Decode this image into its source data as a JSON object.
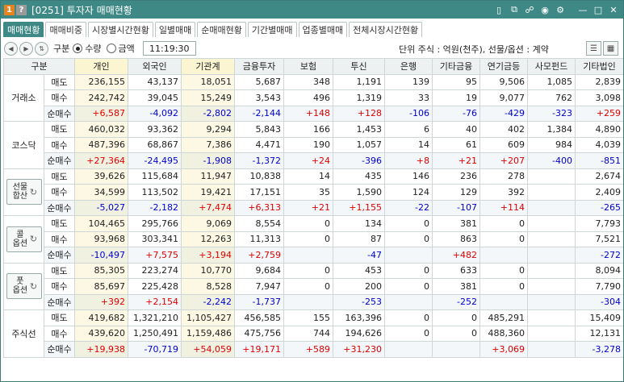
{
  "window": {
    "badge1": "1",
    "badge2": "?",
    "title": "[0251] 투자자 매매현황"
  },
  "tabs": [
    "매매현황",
    "매매비중",
    "시장별시간현황",
    "일별매매",
    "순매매현황",
    "기간별매매",
    "업종별매매",
    "전체시장시간현황"
  ],
  "toolbar": {
    "gubun_label": "구분",
    "radio_qty": "수량",
    "radio_amt": "금액",
    "time": "11:19:30",
    "unit_text": "단위 주식 : 억원(천주), 선물/옵션 : 계약"
  },
  "columns": [
    "구분",
    "개인",
    "외국인",
    "기관계",
    "금융투자",
    "보험",
    "투신",
    "은행",
    "기타금융",
    "연기금등",
    "사모펀드",
    "기타법인"
  ],
  "row_types": [
    "매도",
    "매수",
    "순매수"
  ],
  "groups": [
    {
      "name": "거래소",
      "button": false,
      "rows": [
        [
          "236,155",
          "43,137",
          "18,051",
          "5,687",
          "348",
          "1,191",
          "139",
          "95",
          "9,506",
          "1,085",
          "2,839"
        ],
        [
          "242,742",
          "39,045",
          "15,249",
          "3,543",
          "496",
          "1,319",
          "33",
          "19",
          "9,077",
          "762",
          "3,098"
        ],
        [
          "+6,587",
          "-4,092",
          "-2,802",
          "-2,144",
          "+148",
          "+128",
          "-106",
          "-76",
          "-429",
          "-323",
          "+259"
        ]
      ]
    },
    {
      "name": "코스닥",
      "button": false,
      "rows": [
        [
          "460,032",
          "93,362",
          "9,294",
          "5,843",
          "166",
          "1,453",
          "6",
          "40",
          "402",
          "1,384",
          "4,890"
        ],
        [
          "487,396",
          "68,867",
          "7,386",
          "4,471",
          "190",
          "1,057",
          "14",
          "61",
          "609",
          "984",
          "4,039"
        ],
        [
          "+27,364",
          "-24,495",
          "-1,908",
          "-1,372",
          "+24",
          "-396",
          "+8",
          "+21",
          "+207",
          "-400",
          "-851"
        ]
      ]
    },
    {
      "name": "선물합산",
      "name_lines": [
        "선물",
        "합산"
      ],
      "button": true,
      "rows": [
        [
          "39,626",
          "115,684",
          "11,947",
          "10,838",
          "14",
          "435",
          "146",
          "236",
          "278",
          "",
          "2,674"
        ],
        [
          "34,599",
          "113,502",
          "19,421",
          "17,151",
          "35",
          "1,590",
          "124",
          "129",
          "392",
          "",
          "2,409"
        ],
        [
          "-5,027",
          "-2,182",
          "+7,474",
          "+6,313",
          "+21",
          "+1,155",
          "-22",
          "-107",
          "+114",
          "",
          "-265"
        ]
      ]
    },
    {
      "name": "콜옵션",
      "name_lines": [
        "콜",
        "옵션"
      ],
      "button": true,
      "rows": [
        [
          "104,465",
          "295,766",
          "9,069",
          "8,554",
          "0",
          "134",
          "0",
          "381",
          "0",
          "",
          "7,793"
        ],
        [
          "93,968",
          "303,341",
          "12,263",
          "11,313",
          "0",
          "87",
          "0",
          "863",
          "0",
          "",
          "7,521"
        ],
        [
          "-10,497",
          "+7,575",
          "+3,194",
          "+2,759",
          "",
          "-47",
          "",
          "+482",
          "",
          "",
          "-272"
        ]
      ]
    },
    {
      "name": "풋옵션",
      "name_lines": [
        "풋",
        "옵션"
      ],
      "button": true,
      "rows": [
        [
          "85,305",
          "223,274",
          "10,770",
          "9,684",
          "0",
          "453",
          "0",
          "633",
          "0",
          "",
          "8,094"
        ],
        [
          "85,697",
          "225,428",
          "8,528",
          "7,947",
          "0",
          "200",
          "0",
          "381",
          "0",
          "",
          "7,790"
        ],
        [
          "+392",
          "+2,154",
          "-2,242",
          "-1,737",
          "",
          "-253",
          "",
          "-252",
          "",
          "",
          "-304"
        ]
      ]
    },
    {
      "name": "주식선",
      "button": false,
      "rows": [
        [
          "419,682",
          "1,321,210",
          "1,105,427",
          "456,585",
          "155",
          "163,396",
          "0",
          "0",
          "485,291",
          "",
          "15,409"
        ],
        [
          "439,620",
          "1,250,491",
          "1,159,486",
          "475,756",
          "744",
          "194,626",
          "0",
          "0",
          "488,360",
          "",
          "12,131"
        ],
        [
          "+19,938",
          "-70,719",
          "+54,059",
          "+19,171",
          "+589",
          "+31,230",
          "",
          "",
          "+3,069",
          "",
          "-3,278"
        ]
      ]
    }
  ],
  "colors": {
    "accent": "#3e8985",
    "positive": "#e00000",
    "negative": "#0000d0",
    "highlight_col": "#fbf5d2"
  }
}
